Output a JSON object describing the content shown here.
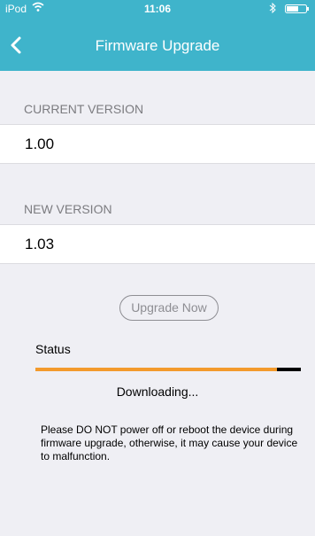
{
  "status_bar": {
    "carrier": "iPod",
    "time": "11:06",
    "wifi_icon": "wifi-icon",
    "bluetooth_icon": "bluetooth-icon",
    "battery_icon": "battery-icon"
  },
  "nav": {
    "back_icon": "chevron-left-icon",
    "title": "Firmware Upgrade"
  },
  "current": {
    "header": "CURRENT VERSION",
    "value": "1.00"
  },
  "new_version": {
    "header": "NEW VERSION",
    "value": "1.03"
  },
  "upgrade_button": "Upgrade Now",
  "status": {
    "label": "Status",
    "progress": 0.91,
    "text": "Downloading..."
  },
  "warning": "Please DO NOT power off or reboot the device during firmware upgrade, otherwise, it may cause your device to malfunction.",
  "colors": {
    "nav_bar": "#3fb4cb",
    "progress_fill": "#f39a2c",
    "progress_track": "#000000",
    "background": "#efeff4"
  }
}
